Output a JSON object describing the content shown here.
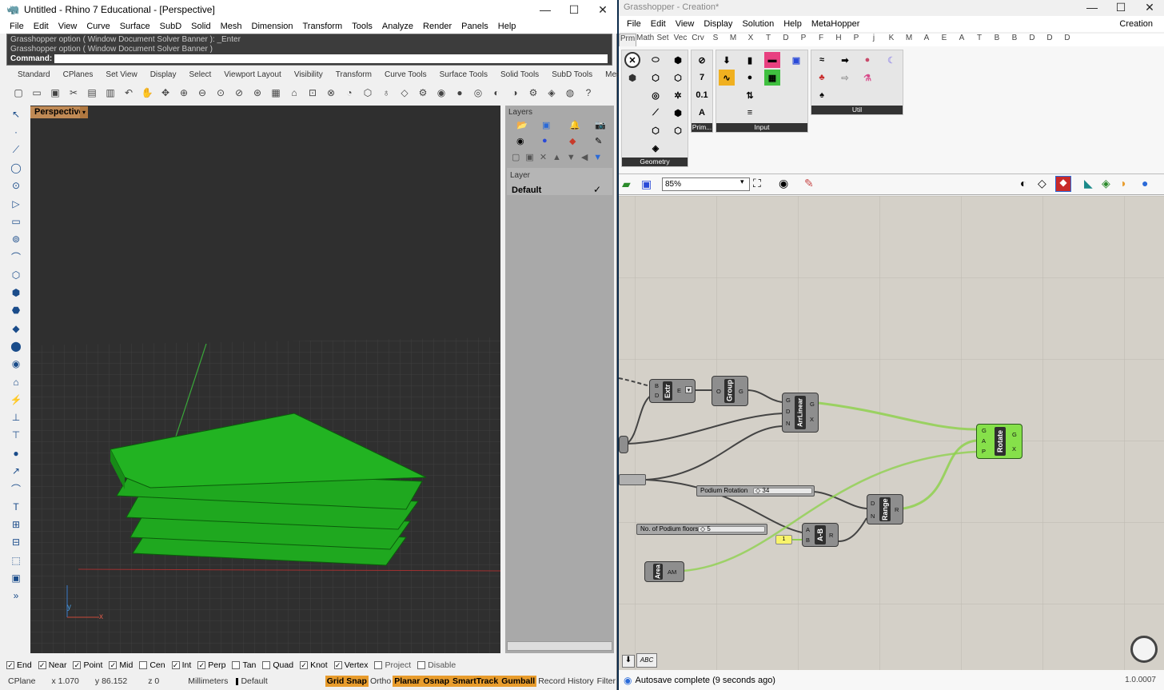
{
  "rhino": {
    "title": "Untitled - Rhino 7 Educational - [Perspective]",
    "menu": [
      "File",
      "Edit",
      "View",
      "Curve",
      "Surface",
      "SubD",
      "Solid",
      "Mesh",
      "Dimension",
      "Transform",
      "Tools",
      "Analyze",
      "Render",
      "Panels",
      "Help"
    ],
    "command_history": [
      "Grasshopper option ( Window  Document  Solver  Banner ): _Enter",
      "Grasshopper option ( Window  Document  Solver  Banner )"
    ],
    "command_prompt": "Command:",
    "toolbar_tabs": [
      "Standard",
      "CPlanes",
      "Set View",
      "Display",
      "Select",
      "Viewport Layout",
      "Visibility",
      "Transform",
      "Curve Tools",
      "Surface Tools",
      "Solid Tools",
      "SubD Tools",
      "Mesh"
    ],
    "viewport": {
      "label": "Perspective",
      "axis_x": "x",
      "axis_y": "y"
    },
    "layers": {
      "title": "Layers",
      "column": "Layer",
      "rows": [
        {
          "name": "Default",
          "current": "✓"
        }
      ]
    },
    "osnaps": [
      {
        "label": "End",
        "checked": true
      },
      {
        "label": "Near",
        "checked": true
      },
      {
        "label": "Point",
        "checked": true
      },
      {
        "label": "Mid",
        "checked": true
      },
      {
        "label": "Cen",
        "checked": false
      },
      {
        "label": "Int",
        "checked": true
      },
      {
        "label": "Perp",
        "checked": true
      },
      {
        "label": "Tan",
        "checked": false
      },
      {
        "label": "Quad",
        "checked": false
      },
      {
        "label": "Knot",
        "checked": true
      },
      {
        "label": "Vertex",
        "checked": true
      },
      {
        "label": "Project",
        "checked": false
      },
      {
        "label": "Disable",
        "checked": false
      }
    ],
    "status": {
      "cplane": "CPlane",
      "x": "x 1.070",
      "y": "y 86.152",
      "z": "z 0",
      "units": "Millimeters",
      "layer": "Default",
      "panes": [
        {
          "label": "Grid Snap",
          "on": true
        },
        {
          "label": "Ortho",
          "on": false
        },
        {
          "label": "Planar",
          "on": true
        },
        {
          "label": "Osnap",
          "on": true
        },
        {
          "label": "SmartTrack",
          "on": true
        },
        {
          "label": "Gumball",
          "on": true
        },
        {
          "label": "Record History",
          "on": false
        },
        {
          "label": "Filter",
          "on": false
        }
      ]
    }
  },
  "gh": {
    "title": "Grasshopper - Creation*",
    "menu": [
      "File",
      "Edit",
      "View",
      "Display",
      "Solution",
      "Help",
      "MetaHopper"
    ],
    "doc_name": "Creation",
    "tabs": [
      "Prm",
      "Math",
      "Set",
      "Vec",
      "Crv",
      "S",
      "M",
      "X",
      "T",
      "D",
      "P",
      "F",
      "H",
      "P",
      "j",
      "K",
      "M",
      "A",
      "E",
      "A",
      "T",
      "B",
      "B",
      "D",
      "D",
      "D"
    ],
    "ribbon_groups": [
      "Geometry",
      "Prim...",
      "Input",
      "Util"
    ],
    "zoom": "85%",
    "nodes": {
      "extr": {
        "name": "Extr",
        "in": [
          "B",
          "D"
        ],
        "out": [
          "E"
        ]
      },
      "group": {
        "name": "Group",
        "in": [
          "O"
        ],
        "out": [
          "G"
        ]
      },
      "arrlinear": {
        "name": "ArrLinear",
        "in": [
          "G",
          "D",
          "N"
        ],
        "out": [
          "G",
          "X"
        ]
      },
      "rotate": {
        "name": "Rotate",
        "in": [
          "G",
          "A",
          "P"
        ],
        "out": [
          "G",
          "X"
        ]
      },
      "range": {
        "name": "Range",
        "in": [
          "D",
          "N"
        ],
        "out": [
          "R"
        ]
      },
      "amb": {
        "name": "A-B",
        "in": [
          "A",
          "B"
        ],
        "out": [
          "R"
        ]
      },
      "area": {
        "name": "Area",
        "out": [
          "AM"
        ]
      }
    },
    "sliders": [
      {
        "label": "Podium Rotation",
        "value": "◇ 34"
      },
      {
        "label": "No. of Podium floors",
        "value": "◇ 5"
      }
    ],
    "panel_value": "1",
    "status": "Autosave complete (9 seconds ago)",
    "version": "1.0.0007"
  },
  "colors": {
    "geometry_green": "#1fa81f",
    "wire_green": "#8fd14f",
    "rotate_node": "#86e04a"
  }
}
